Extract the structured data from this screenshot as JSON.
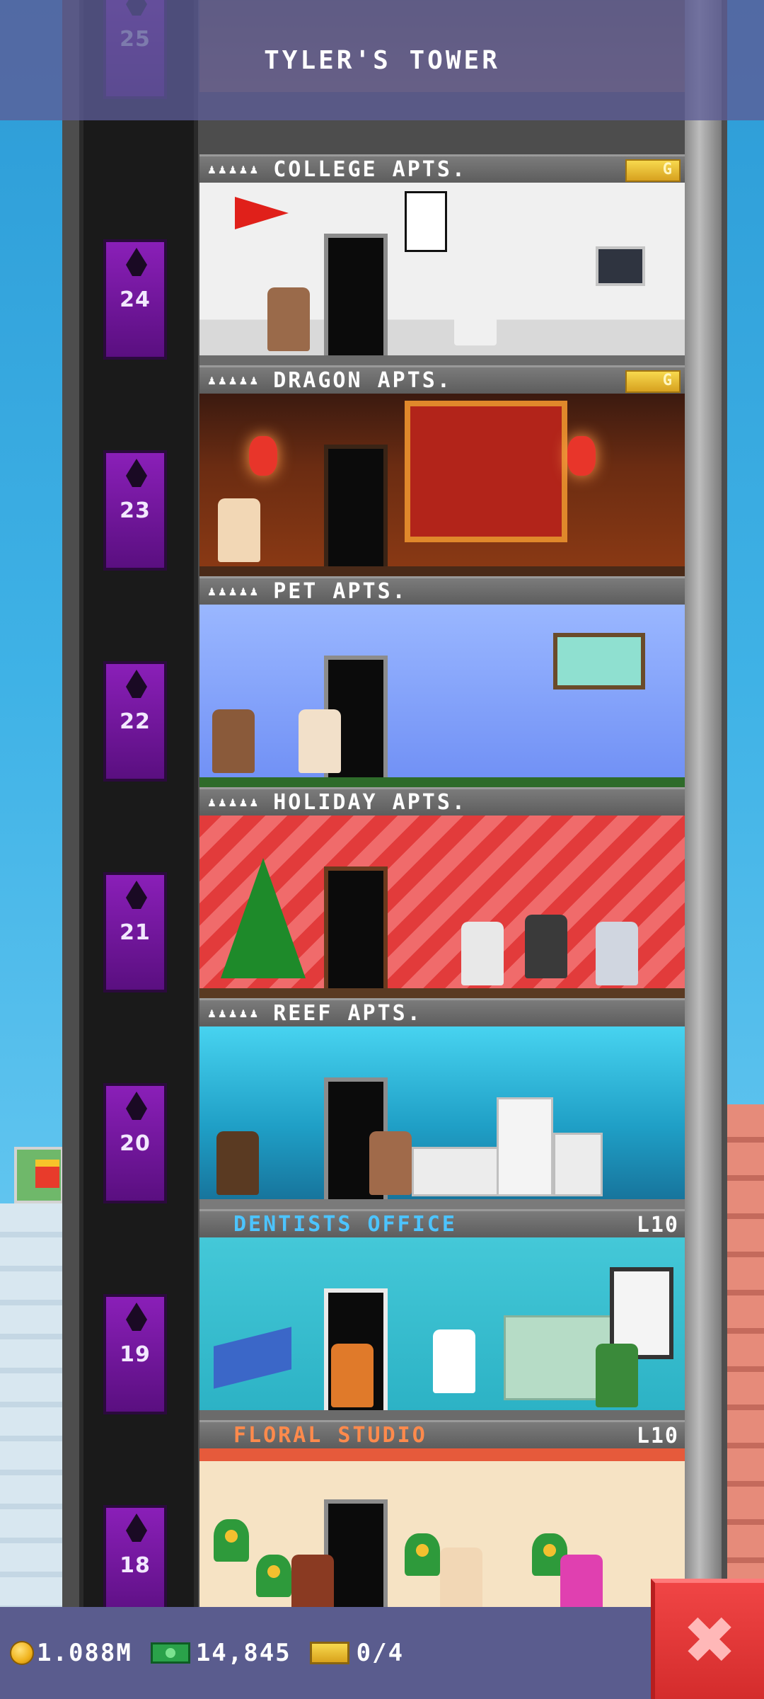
{
  "title_bar": {
    "tower_name": "TYLER'S TOWER"
  },
  "elevator": {
    "floors": [
      {
        "number": "25"
      },
      {
        "number": "24"
      },
      {
        "number": "23"
      },
      {
        "number": "22"
      },
      {
        "number": "21"
      },
      {
        "number": "20"
      },
      {
        "number": "19"
      },
      {
        "number": "18"
      }
    ]
  },
  "floors": [
    {
      "name": "COLLEGE APTS.",
      "type": "residential",
      "residents_icons": "♟♟♟♟♟",
      "badge": "G"
    },
    {
      "name": "DRAGON APTS.",
      "type": "residential",
      "residents_icons": "♟♟♟♟♟",
      "badge": "G"
    },
    {
      "name": "PET APTS.",
      "type": "residential",
      "residents_icons": "♟♟♟♟♟"
    },
    {
      "name": "HOLIDAY APTS.",
      "type": "residential",
      "residents_icons": "♟♟♟♟♟"
    },
    {
      "name": "REEF APTS.",
      "type": "residential",
      "residents_icons": "♟♟♟♟♟"
    },
    {
      "name": "DENTISTS OFFICE",
      "type": "business",
      "level": "L10"
    },
    {
      "name": "FLORAL STUDIO",
      "type": "business",
      "level": "L10"
    }
  ],
  "status_bar": {
    "coins": "1.088M",
    "tower_bux": "14,845",
    "tickets": "0/4"
  },
  "close_button": {
    "glyph": "✖"
  },
  "colors": {
    "elevator_purple": "#8a1fb8",
    "title_bar": "#5c5c96",
    "close_red": "#e03a3a",
    "dentist_label": "#4cc4ff",
    "floral_label": "#ff8a4c"
  },
  "icons": [
    "coin-icon",
    "tower-bux-icon",
    "golden-ticket-icon",
    "close-icon",
    "resident-icon"
  ]
}
